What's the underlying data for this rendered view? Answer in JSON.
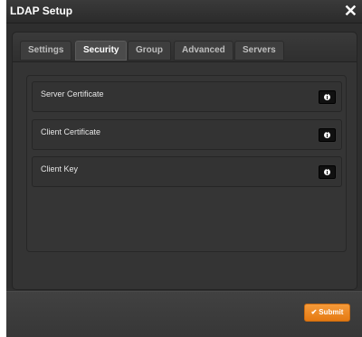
{
  "window": {
    "title": "LDAP Setup",
    "close_icon": "close-icon"
  },
  "tabs": [
    {
      "label": "Settings",
      "active": false
    },
    {
      "label": "Security",
      "active": true
    },
    {
      "label": "Group",
      "active": false
    },
    {
      "label": "Advanced",
      "active": false
    },
    {
      "label": "Servers",
      "active": false
    }
  ],
  "security": {
    "rows": [
      {
        "label": "Server Certificate",
        "icon": "info-icon"
      },
      {
        "label": "Client Certificate",
        "icon": "info-icon"
      },
      {
        "label": "Client Key",
        "icon": "info-icon"
      }
    ]
  },
  "footer": {
    "submit_label": "Submit",
    "submit_icon": "check-icon"
  },
  "colors": {
    "accent": "#f08a24",
    "background": "#2f2f2f"
  }
}
